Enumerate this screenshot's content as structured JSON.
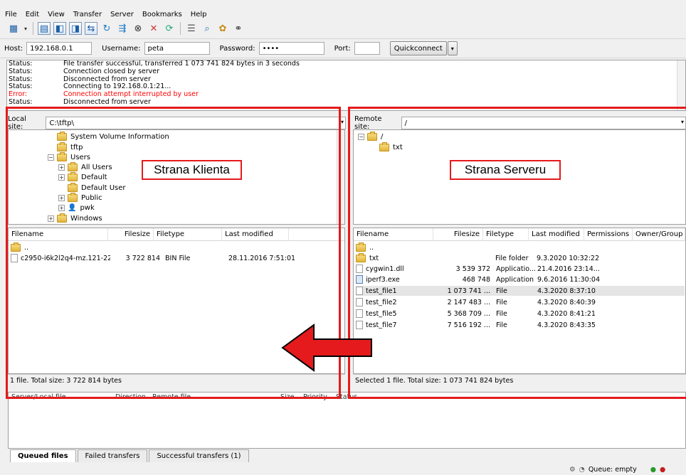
{
  "menu": [
    "File",
    "Edit",
    "View",
    "Transfer",
    "Server",
    "Bookmarks",
    "Help"
  ],
  "quickconnect": {
    "host_label": "Host:",
    "host_value": "192.168.0.1",
    "user_label": "Username:",
    "user_value": "peta",
    "pass_label": "Password:",
    "pass_value": "••••",
    "port_label": "Port:",
    "port_value": "",
    "button": "Quickconnect"
  },
  "log": [
    {
      "k": "Status:",
      "v": "File transfer successful, transferred 1 073 741 824 bytes in 3 seconds",
      "err": false
    },
    {
      "k": "Status:",
      "v": "Connection closed by server",
      "err": false
    },
    {
      "k": "Status:",
      "v": "Disconnected from server",
      "err": false
    },
    {
      "k": "Status:",
      "v": "Connecting to 192.168.0.1:21...",
      "err": false
    },
    {
      "k": "Error:",
      "v": "Connection attempt interrupted by user",
      "err": true
    },
    {
      "k": "Status:",
      "v": "Disconnected from server",
      "err": false
    }
  ],
  "local": {
    "site_label": "Local site:",
    "site_path": "C:\\tftp\\",
    "tree": [
      "System Volume Information",
      "tftp",
      "Users",
      "All Users",
      "Default",
      "Default User",
      "Public",
      "pwk",
      "Windows"
    ],
    "columns": [
      "Filename",
      "Filesize",
      "Filetype",
      "Last modified"
    ],
    "files": [
      {
        "name": "..",
        "size": "",
        "type": "",
        "modified": ""
      },
      {
        "name": "c2950-i6k2l2q4-mz.121-22...",
        "size": "3 722 814",
        "type": "BIN File",
        "modified": "28.11.2016 7:51:01"
      }
    ],
    "status": "1 file. Total size: 3 722 814 bytes"
  },
  "remote": {
    "site_label": "Remote site:",
    "site_path": "/",
    "tree": [
      "/",
      "txt"
    ],
    "columns": [
      "Filename",
      "Filesize",
      "Filetype",
      "Last modified",
      "Permissions",
      "Owner/Group"
    ],
    "files": [
      {
        "name": "..",
        "size": "",
        "type": "",
        "modified": ""
      },
      {
        "name": "txt",
        "size": "",
        "type": "File folder",
        "modified": "9.3.2020 10:32:22"
      },
      {
        "name": "cygwin1.dll",
        "size": "3 539 372",
        "type": "Applicatio...",
        "modified": "21.4.2016 23:14..."
      },
      {
        "name": "iperf3.exe",
        "size": "468 748",
        "type": "Application",
        "modified": "9.6.2016 11:30:04"
      },
      {
        "name": "test_file1",
        "size": "1 073 741 ...",
        "type": "File",
        "modified": "4.3.2020 8:37:10"
      },
      {
        "name": "test_file2",
        "size": "2 147 483 ...",
        "type": "File",
        "modified": "4.3.2020 8:40:39"
      },
      {
        "name": "test_file5",
        "size": "5 368 709 ...",
        "type": "File",
        "modified": "4.3.2020 8:41:21"
      },
      {
        "name": "test_file7",
        "size": "7 516 192 ...",
        "type": "File",
        "modified": "4.3.2020 8:43:35"
      }
    ],
    "status": "Selected 1 file. Total size: 1 073 741 824 bytes"
  },
  "queue": {
    "columns": [
      "Server/Local file",
      "Direction",
      "Remote file",
      "Size",
      "Priority",
      "Status"
    ],
    "tabs": [
      "Queued files",
      "Failed transfers",
      "Successful transfers (1)"
    ],
    "footer": "Queue: empty"
  },
  "annotations": {
    "client": "Strana Klienta",
    "server": "Strana Serveru"
  },
  "colors": {
    "annotation_red": "#e41a1c",
    "error_text": "#ff0000",
    "selected_row": "#e5e5e5"
  }
}
